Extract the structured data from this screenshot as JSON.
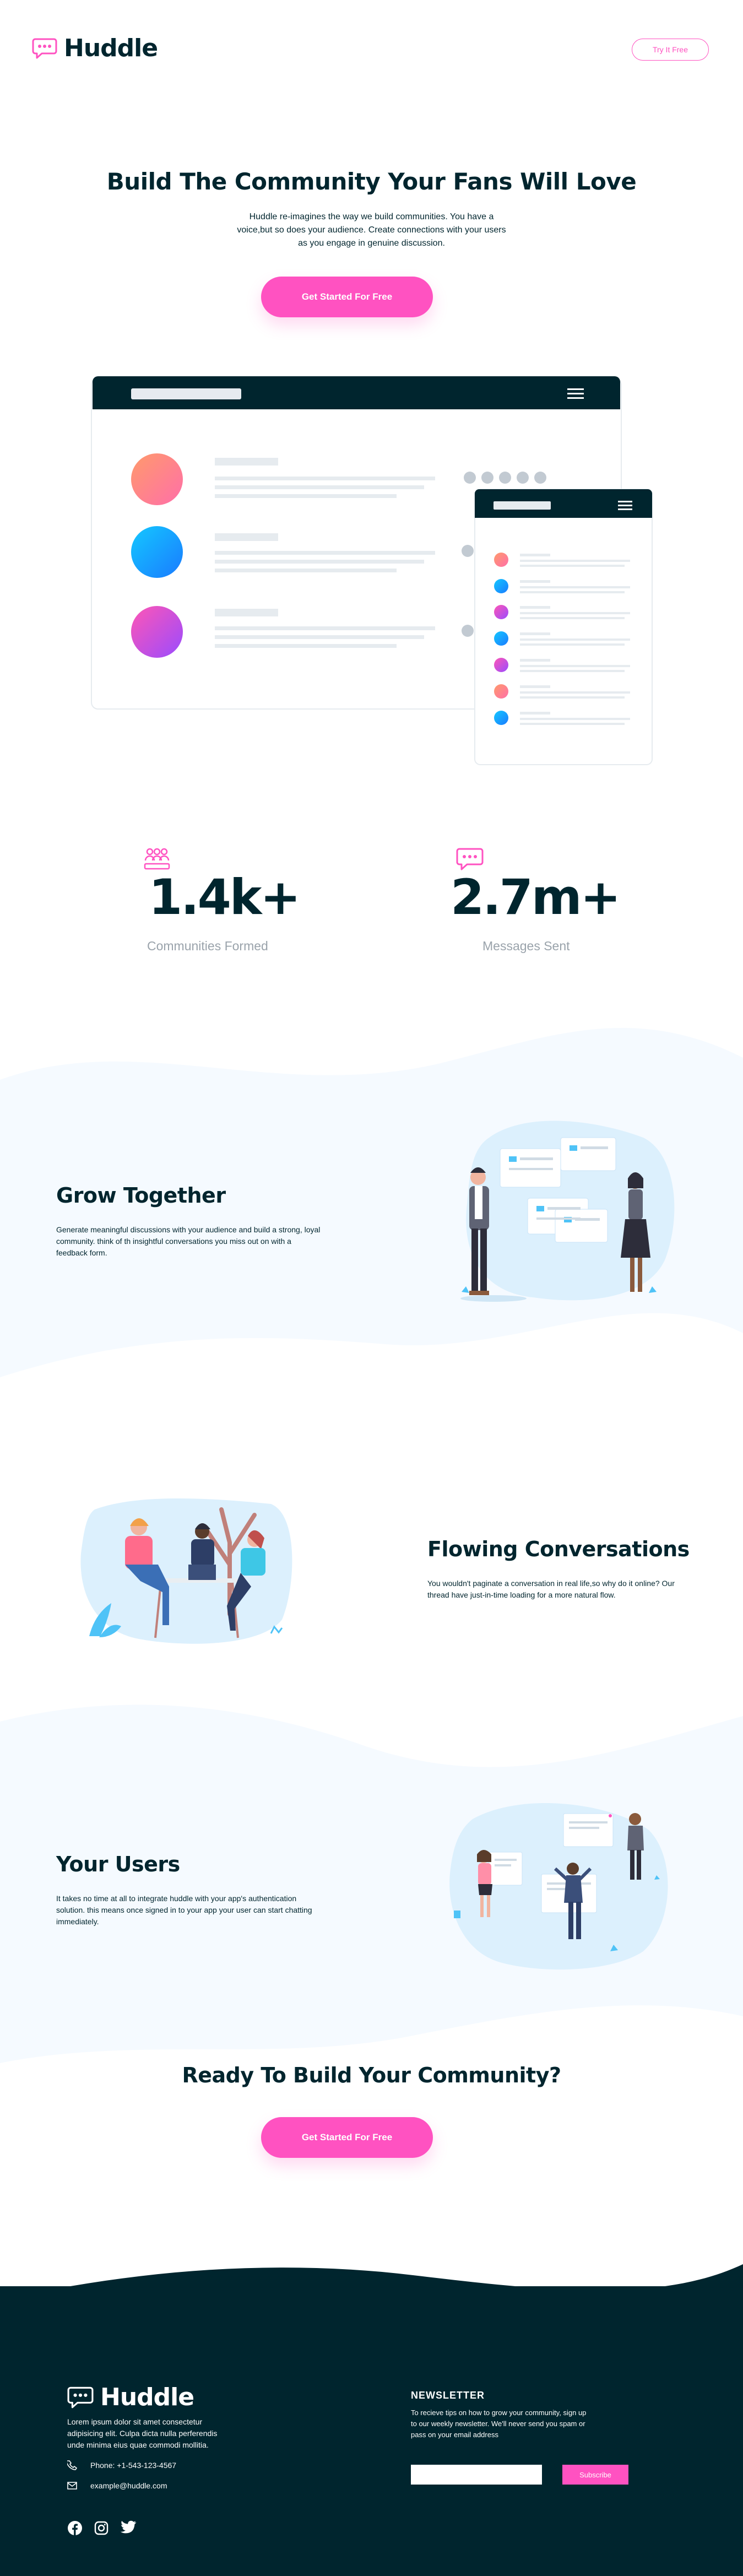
{
  "header": {
    "brand": "Huddle",
    "try_button": "Try It Free"
  },
  "hero": {
    "title": "Build The Community Your Fans Will Love",
    "text": "Huddle re-imagines the way we build communities. You have a voice,but so does your audience. Create connections with your users as you engage in genuine discussion.",
    "cta": "Get Started For Free"
  },
  "stats": [
    {
      "number": "1.4k+",
      "label": "Communities Formed",
      "icon": "communities-icon"
    },
    {
      "number": "2.7m+",
      "label": "Messages Sent",
      "icon": "messages-icon"
    }
  ],
  "features": [
    {
      "title": "Grow Together",
      "text": "Generate meaningful discussions with your audience and build a strong, loyal community. think of th insightful conversations you miss out on with a feedback form."
    },
    {
      "title": "Flowing Conversations",
      "text": "You wouldn't paginate a conversation in real life,so why do it online? Our thread have just-in-time loading for a more natural flow."
    },
    {
      "title": "Your Users",
      "text": "It takes no time at all to integrate huddle with your app's authentication solution. this means once signed in to your app your user can start chatting immediately."
    }
  ],
  "cta_section": {
    "title": "Ready To Build Your Community?",
    "button": "Get Started For Free"
  },
  "footer": {
    "brand": "Huddle",
    "about": "Lorem ipsum dolor sit amet consectetur adipisicing elit. Culpa dicta nulla perferendis unde minima eius quae commodi mollitia.",
    "phone": "Phone: +1-543-123-4567",
    "email": "example@huddle.com",
    "newsletter_title": "NEWSLETTER",
    "newsletter_text": "To recieve tips on how to grow your community, sign up to our weekly newsletter. We'll never send you spam or pass on your email address",
    "email_placeholder": "",
    "subscribe": "Subscribe",
    "social_icons": [
      "facebook-icon",
      "instagram-icon",
      "twitter-icon"
    ]
  },
  "colors": {
    "dark": "#00252e",
    "pink": "#ff52c1",
    "light_blue": "#f5faff",
    "gray": "#9aa3ab"
  }
}
